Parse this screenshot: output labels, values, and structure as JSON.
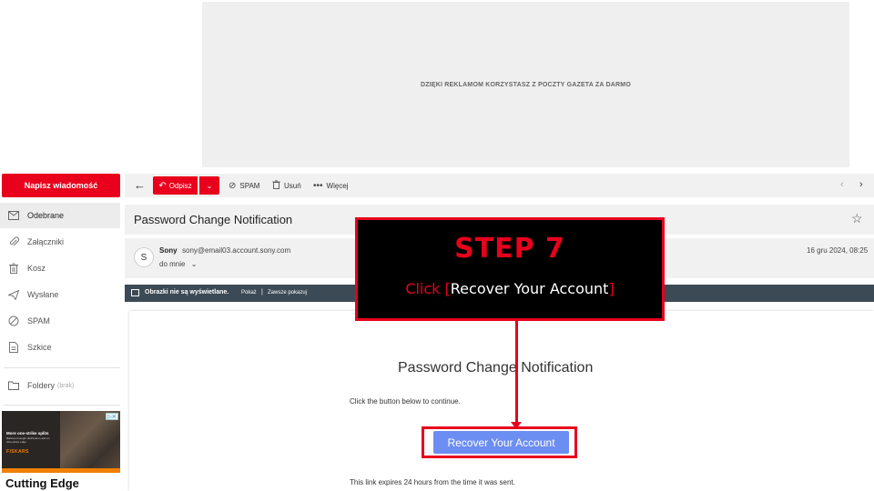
{
  "ad_banner": {
    "text": "DZIĘKI REKLAMOM KORZYSTASZ Z POCZTY GAZETA ZA DARMO"
  },
  "sidebar": {
    "compose_label": "Napisz wiadomość",
    "items": [
      {
        "label": "Odebrane",
        "icon": "inbox-icon"
      },
      {
        "label": "Załączniki",
        "icon": "paperclip-icon"
      },
      {
        "label": "Kosz",
        "icon": "trash-icon"
      },
      {
        "label": "Wysłane",
        "icon": "send-icon"
      },
      {
        "label": "SPAM",
        "icon": "spam-icon"
      },
      {
        "label": "Szkice",
        "icon": "draft-icon"
      }
    ],
    "folders_label": "Foldery",
    "folders_note": "(brak)",
    "ad": {
      "headline": "More one-strike splits",
      "subtext": "Balanced weight distribution and an ultra-sharp edge",
      "brand": "FISKARS",
      "title": "Cutting Edge"
    }
  },
  "toolbar": {
    "reply_label": "Odpisz",
    "spam_label": "SPAM",
    "delete_label": "Usuń",
    "more_label": "Więcej"
  },
  "email": {
    "subject": "Password Change Notification",
    "sender_initial": "S",
    "sender_name": "Sony",
    "sender_email": "sony@email03.account.sony.com",
    "recipient": "do mnie",
    "date": "16 gru 2024, 08:25",
    "images_blocked": "Obrazki nie są wyświetlane.",
    "show_label": "Pokaż",
    "separator": "|",
    "always_show_label": "Zawsze pokazuj",
    "body_heading": "Password Change Notification",
    "body_instruction": "Click the button below to continue.",
    "button_label": "Recover Your Account",
    "expiry_text": "This link expires 24 hours from the time it was sent."
  },
  "overlay": {
    "step_title": "STEP 7",
    "click_word": "Click",
    "bracket_open": "[",
    "target": "Recover Your Account",
    "bracket_close": "]"
  },
  "colors": {
    "accent": "#e8001c",
    "button": "#6c8ef2",
    "image_bar": "#3c4a55"
  }
}
